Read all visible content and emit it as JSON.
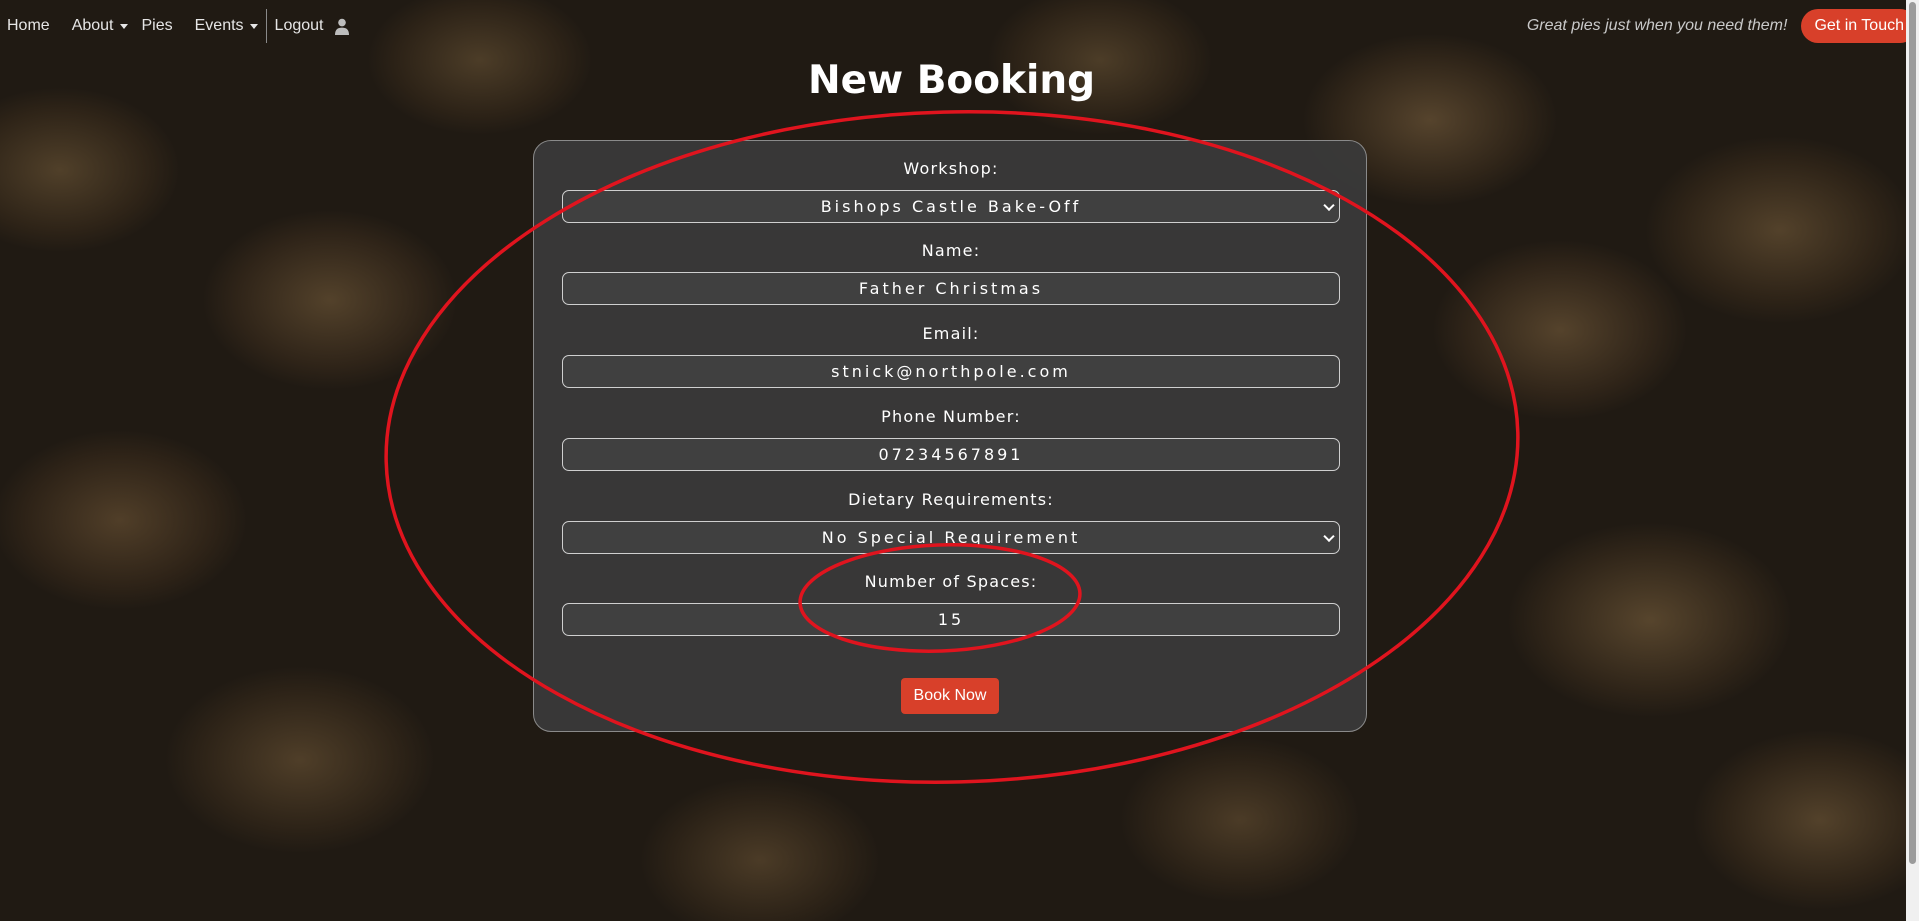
{
  "nav": {
    "links": [
      {
        "label": "Home"
      },
      {
        "label": "About"
      },
      {
        "label": "Pies"
      },
      {
        "label": "Events"
      },
      {
        "label": "Logout"
      }
    ],
    "user_icon": "user-icon",
    "tagline": "Great pies just when you need them!",
    "cta_label": "Get in Touch"
  },
  "page": {
    "title": "New Booking"
  },
  "form": {
    "workshop": {
      "label": "Workshop:",
      "value": "Bishops Castle Bake-Off"
    },
    "name": {
      "label": "Name:",
      "value": "Father Christmas"
    },
    "email": {
      "label": "Email:",
      "value": "stnick@northpole.com"
    },
    "phone": {
      "label": "Phone Number:",
      "value": "07234567891"
    },
    "dietary": {
      "label": "Dietary Requirements:",
      "value": "No Special Requirement"
    },
    "spaces": {
      "label": "Number of Spaces:",
      "value": "15"
    },
    "submit_label": "Book Now"
  },
  "colors": {
    "accent": "#d8402a",
    "annotation": "#e0141e",
    "card_background": "#3a3a3a"
  }
}
